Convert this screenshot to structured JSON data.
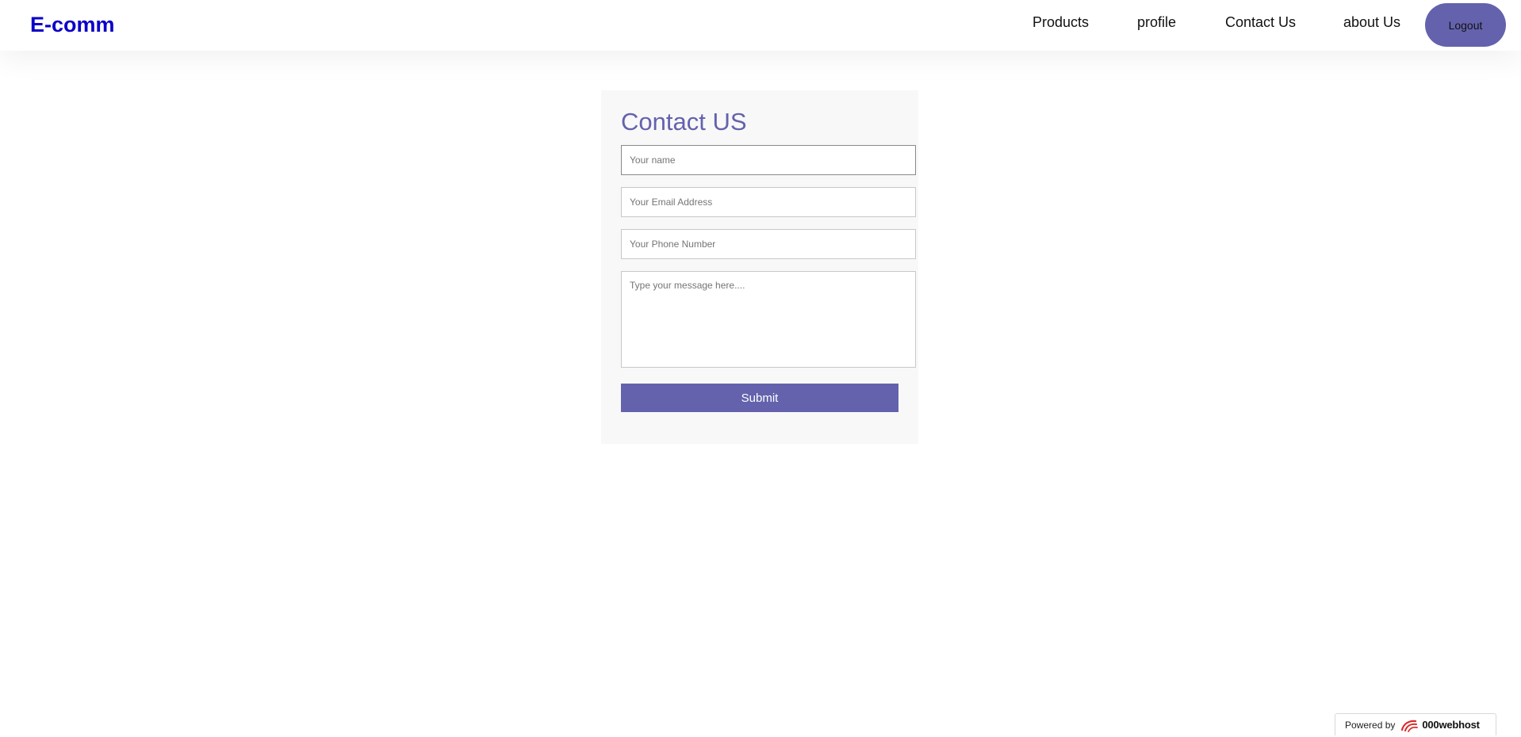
{
  "navbar": {
    "brand": "E-comm",
    "links": [
      {
        "label": "Products"
      },
      {
        "label": "profile"
      },
      {
        "label": "Contact Us"
      },
      {
        "label": "about Us"
      }
    ],
    "logout_label": "Logout"
  },
  "contact_form": {
    "title": "Contact US",
    "name_placeholder": "Your name",
    "email_placeholder": "Your Email Address",
    "phone_placeholder": "Your Phone Number",
    "message_placeholder": "Type your message here....",
    "submit_label": "Submit"
  },
  "footer_badge": {
    "powered_by": "Powered by",
    "host_name": "000webhost"
  },
  "colors": {
    "brand": "#0b00c9",
    "accent": "#6462ad",
    "card_background": "#f8f8f8",
    "host_logo": "#d92b2b"
  },
  "icons": {
    "host_logo": "000webhost-logo-icon"
  }
}
